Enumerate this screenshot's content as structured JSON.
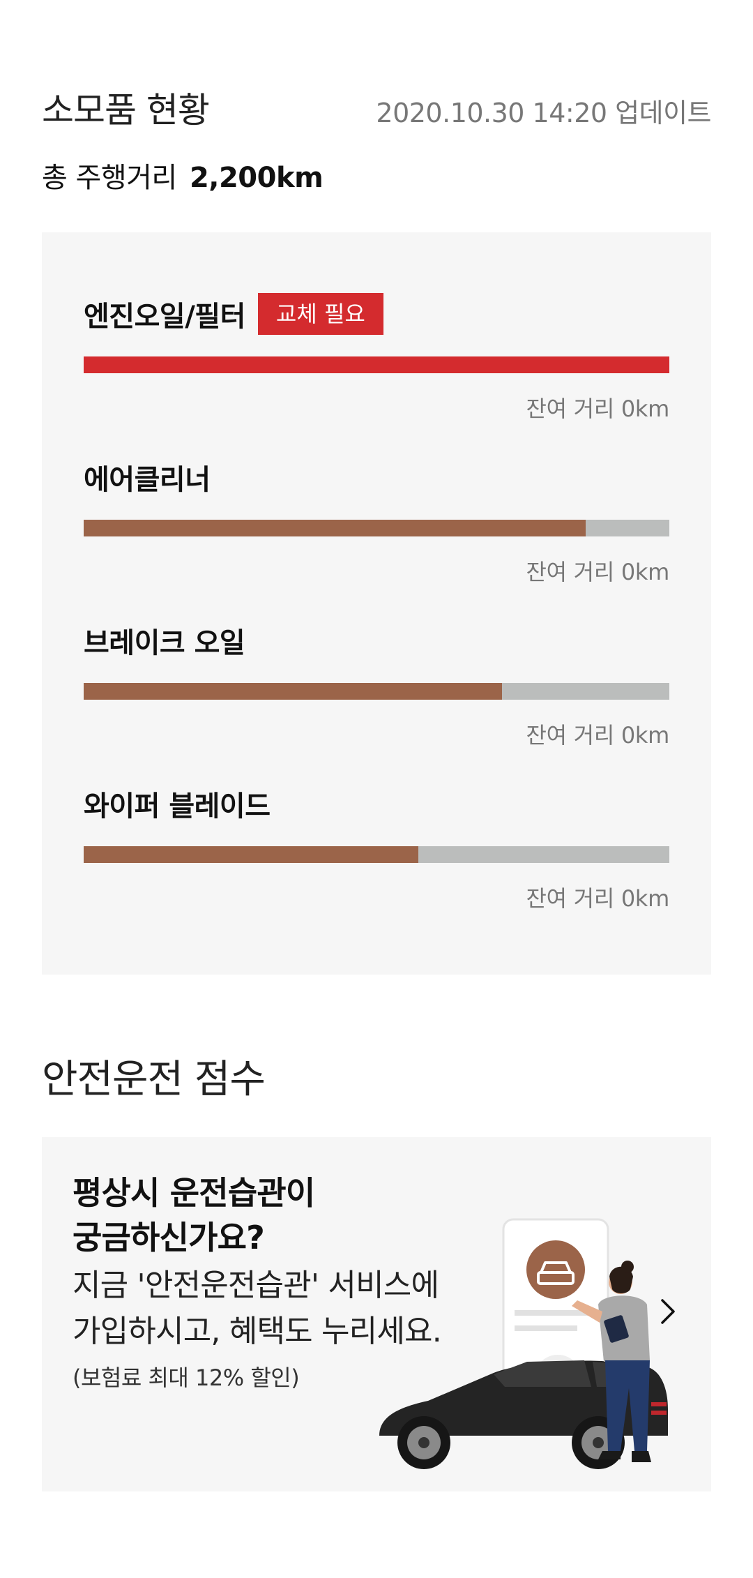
{
  "consumables": {
    "title": "소모품 현황",
    "updated": "2020.10.30 14:20 업데이트",
    "mileage_label": "총 주행거리",
    "mileage_value": "2,200km",
    "items": [
      {
        "label": "엔진오일/필터",
        "badge": "교체 필요",
        "level": 1.0,
        "remaining": "잔여 거리 0km"
      },
      {
        "label": "에어클리너",
        "level": 0.857,
        "remaining": "잔여 거리 0km"
      },
      {
        "label": "브레이크 오일",
        "level": 0.714,
        "remaining": "잔여 거리 0km"
      },
      {
        "label": "와이퍼 블레이드",
        "level": 0.571,
        "remaining": "잔여 거리 0km"
      }
    ]
  },
  "safe_driving": {
    "title": "안전운전 점수",
    "heading_line1": "평상시 운전습관이",
    "heading_line2": "궁금하신가요?",
    "body_line1": "지금 '안전운전습관' 서비스에",
    "body_line2": "가입하시고, 혜택도 누리세요.",
    "note": "(보험료 최대 12% 할인)"
  },
  "colors": {
    "alert": "#d42b2e",
    "progress": "#9b6449",
    "track": "#bbbdbc",
    "card_bg": "#f6f6f6"
  },
  "icons": {
    "arrow": "chevron-right-icon",
    "illustration": "car-with-person-illustration"
  }
}
